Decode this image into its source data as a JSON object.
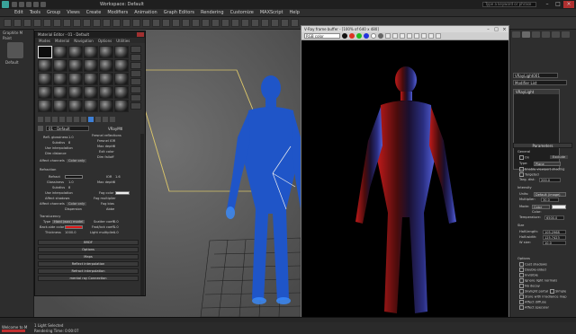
{
  "app": {
    "title": "Workspace: Default",
    "search_placeholder": "Type a keyword or phrase"
  },
  "menubar": [
    "Edit",
    "Tools",
    "Group",
    "Views",
    "Create",
    "Modifiers",
    "Animation",
    "Graph Editors",
    "Rendering",
    "Customize",
    "MAXScript",
    "Help"
  ],
  "left_strip": {
    "label1": "Graphite M",
    "label2": "Paint",
    "label3": "Default"
  },
  "material_editor": {
    "title": "Material Editor - 01 - Default",
    "menu": [
      "Modes",
      "Material",
      "Navigation",
      "Options",
      "Utilities"
    ],
    "material_name": "01 - Default",
    "material_type": "VRayMtl",
    "params": {
      "refl_glossiness_label": "Refl. glossiness",
      "refl_glossiness_value": "1.0",
      "subdivs_label": "Subdivs",
      "subdivs_value": "8",
      "use_interpolation": "Use interpolation",
      "dim_distance": "Dim distance",
      "affect_channels_label": "Affect channels",
      "affect_channels_value": "Color only",
      "fresnel_reflections": "Fresnel reflections",
      "fresnel_ior": "Fresnel IOR",
      "max_depth_label": "Max depth",
      "max_depth_value": "5",
      "exit_color": "Exit color",
      "dim_falloff": "Dim falloff",
      "refraction_header": "Refraction",
      "refract_label": "Refract",
      "glossiness_label": "Glossiness",
      "glossiness_value": "1.0",
      "ior_label": "IOR",
      "ior_value": "1.6",
      "max_depth2_value": "5",
      "fog_color": "Fog color",
      "fog_multiplier": "Fog multiplier",
      "fog_bias": "Fog bias",
      "affect_shadows": "Affect shadows",
      "dispersion": "Dispersion",
      "abbe": "Abbe",
      "translucency_header": "Translucency",
      "type_label": "Type",
      "type_value": "Hard (wax) model",
      "scatter_coeff": "Scatter coeff",
      "scatter_value": "0.0",
      "backside_color": "Back-side color",
      "fwd_bck_coeff": "Fwd/bck coeff",
      "fwd_bck_value": "1.0",
      "thickness_label": "Thickness",
      "thickness_value": "1000.0",
      "light_multiplier": "Light multiplier",
      "light_mult_value": "1.0"
    },
    "rollouts": [
      "BRDF",
      "Options",
      "Maps",
      "Reflect interpolation",
      "Refract interpolation",
      "mental ray Connection"
    ],
    "backside_color_hex": "#e01818"
  },
  "frame_buffer": {
    "title": "V-Ray frame buffer - [100% of 640 x 480]",
    "channel": "RGB color"
  },
  "command_panel": {
    "object_name": "VRayLight001",
    "modifier_list": "Modifier List",
    "stack_item": "VRayLight",
    "rollout_parameters": "Parameters",
    "general": "General",
    "on_label": "On",
    "exclude_label": "Exclude",
    "type_label": "Type:",
    "type_value": "Plane",
    "enable_viewport_shading": "Enable viewport shading",
    "targeted": "Targeted",
    "targ_dist_label": "Targ. dist:",
    "targ_dist_value": "200.0",
    "intensity": "Intensity",
    "units_label": "Units:",
    "units_value": "Default (image)",
    "multiplier_label": "Multiplier:",
    "multiplier_value": "30.0",
    "mode_label": "Mode:",
    "mode_value": "Color",
    "color_label": "Color:",
    "temperature_label": "Temperature:",
    "temperature_value": "6500.0",
    "size": "Size",
    "half_length_label": "Half-length:",
    "half_length_value": "105.2968",
    "half_width_label": "Half-width:",
    "half_width_value": "125.7423",
    "w_size_label": "W size:",
    "w_size_value": "10.0",
    "options": "Options",
    "cast_shadows": "Cast shadows",
    "double_sided": "Double-sided",
    "invisible": "Invisible",
    "ignore_light_normals": "Ignore light normals",
    "no_decay": "No decay",
    "skylight_portal": "Skylight portal",
    "simple": "Simple",
    "store_with_irradiance_map": "Store with irradiance map",
    "affect_diffuse": "Affect diffuse",
    "affect_specular": "Affect specular"
  },
  "status": {
    "maxscript_label": "Welcome to M",
    "line1": "1 Light Selected",
    "line2": "Rendering Time: 0:00:07"
  },
  "colors": {
    "accent": "#3d7fd6",
    "close": "#b03030"
  }
}
